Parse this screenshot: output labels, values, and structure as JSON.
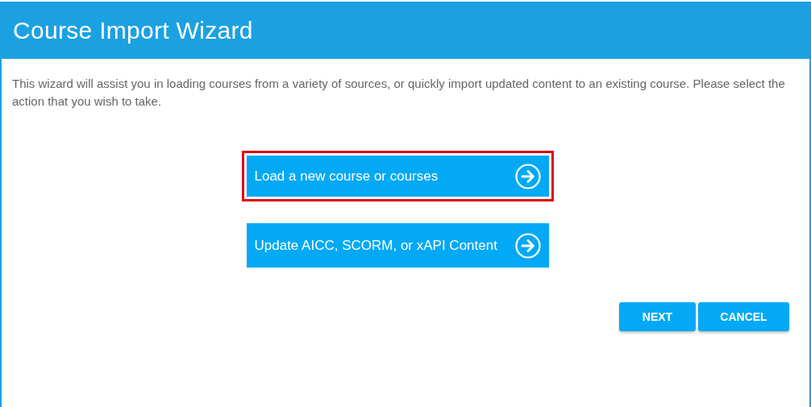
{
  "window": {
    "title": "Course Import Wizard"
  },
  "intro": "This wizard will assist you in loading courses from a variety of sources, or quickly import updated content to an existing course. Please select the action that you wish to take.",
  "options": [
    {
      "label": "Load a new course or courses",
      "selected": true
    },
    {
      "label": "Update AICC, SCORM, or xAPI Content",
      "selected": false
    }
  ],
  "buttons": [
    "NEXT",
    "CANCEL"
  ]
}
